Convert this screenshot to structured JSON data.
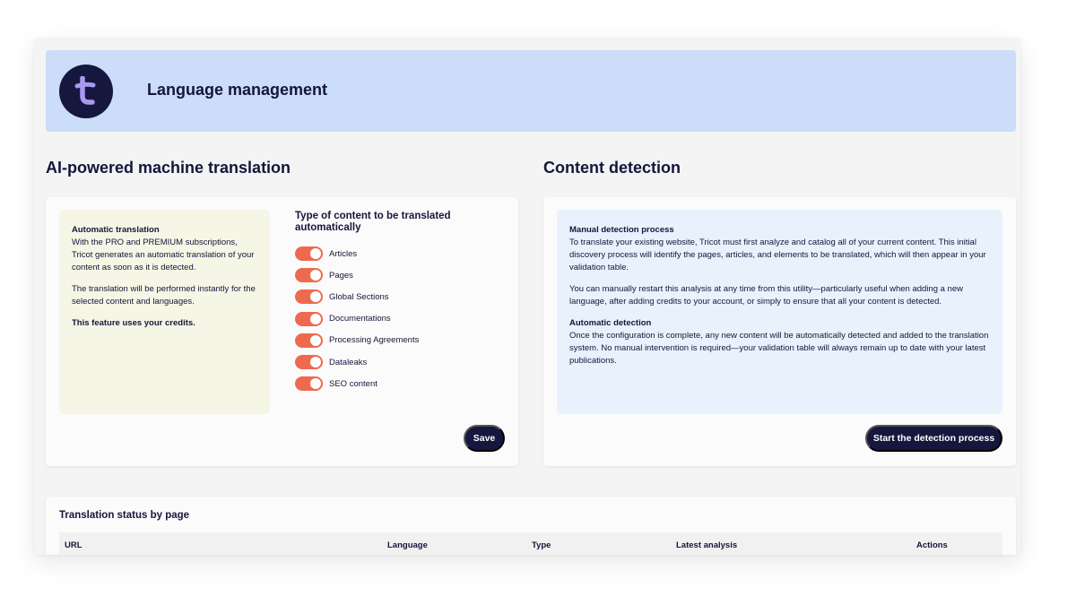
{
  "header": {
    "title": "Language management",
    "logo_icon": "tricot-logo-icon",
    "logo_letter": "t"
  },
  "translation": {
    "title": "AI-powered machine translation",
    "note": {
      "heading": "Automatic translation",
      "body": "With the PRO and PREMIUM subscriptions, Tricot generates an automatic translation of your content as soon as it is detected.",
      "para2": "The translation will be performed instantly for the selected content and languages.",
      "credits": "This feature uses your credits."
    },
    "types_title": "Type of content to be translated automatically",
    "toggles": [
      {
        "label": "Articles",
        "on": true
      },
      {
        "label": "Pages",
        "on": true
      },
      {
        "label": "Global Sections",
        "on": true
      },
      {
        "label": "Documentations",
        "on": true
      },
      {
        "label": "Processing Agreements",
        "on": true
      },
      {
        "label": "Dataleaks",
        "on": true
      },
      {
        "label": "SEO content",
        "on": true
      }
    ],
    "save_label": "Save"
  },
  "detection": {
    "title": "Content detection",
    "manual_heading": "Manual detection process",
    "manual_body": "To translate your existing website, Tricot must first analyze and catalog all of your current content. This initial discovery process will identify the pages, articles, and elements to be translated, which will then appear in your validation table.",
    "manual_body2": "You can manually restart this analysis at any time from this utility—particularly useful when adding a new language, after adding credits to your account, or simply to ensure that all your content is detected.",
    "auto_heading": "Automatic detection",
    "auto_body": "Once the configuration is complete, any new content will be automatically detected and added to the translation system. No manual intervention is required—your validation table will always remain up to date with your latest publications.",
    "button_label": "Start the detection process"
  },
  "status_table": {
    "title": "Translation status by page",
    "columns": [
      "URL",
      "Language",
      "Type",
      "Latest analysis",
      "Actions"
    ]
  },
  "colors": {
    "header_bg": "#cbddf9",
    "navy": "#15173f",
    "toggle_on": "#ee6a4e",
    "note_bg": "#f5f6e5",
    "info_bg": "#e9f1fd"
  }
}
